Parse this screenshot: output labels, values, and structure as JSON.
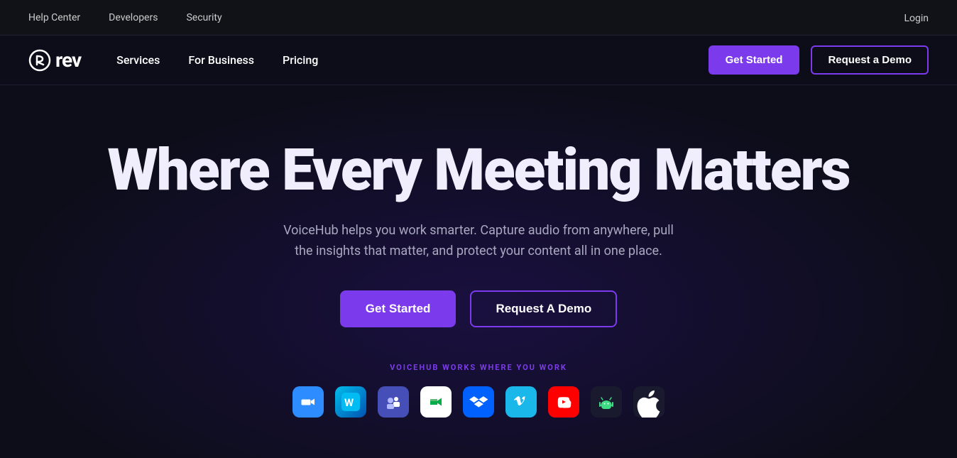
{
  "topbar": {
    "links": [
      "Help Center",
      "Developers",
      "Security"
    ],
    "login_label": "Login"
  },
  "nav": {
    "logo_text": "rev",
    "links": [
      "Services",
      "For Business",
      "Pricing"
    ],
    "get_started_label": "Get Started",
    "request_demo_label": "Request a Demo"
  },
  "hero": {
    "title": "Where Every Meeting Matters",
    "subtitle": "VoiceHub helps you work smarter. Capture audio from anywhere, pull the insights that matter, and protect your content all in one place.",
    "cta_primary": "Get Started",
    "cta_secondary": "Request A Demo",
    "works_label": "VOICEHUB WORKS WHERE YOU WORK",
    "apps": [
      {
        "name": "zoom",
        "label": "Zoom",
        "class": "app-icon-zoom",
        "symbol": "🎥"
      },
      {
        "name": "webex",
        "label": "Webex",
        "class": "app-icon-webex",
        "symbol": "🔵"
      },
      {
        "name": "teams",
        "label": "Teams",
        "class": "app-icon-teams",
        "symbol": "T"
      },
      {
        "name": "meet",
        "label": "Google Meet",
        "class": "app-icon-meet",
        "symbol": "📅"
      },
      {
        "name": "dropbox",
        "label": "Dropbox",
        "class": "app-icon-dropbox",
        "symbol": "📦"
      },
      {
        "name": "vimeo",
        "label": "Vimeo",
        "class": "app-icon-vimeo",
        "symbol": "V"
      },
      {
        "name": "youtube",
        "label": "YouTube",
        "class": "app-icon-youtube",
        "symbol": "▶"
      },
      {
        "name": "android",
        "label": "Android",
        "class": "app-icon-android",
        "symbol": "🤖"
      },
      {
        "name": "apple",
        "label": "Apple",
        "class": "app-icon-apple",
        "symbol": "🍎"
      }
    ]
  }
}
